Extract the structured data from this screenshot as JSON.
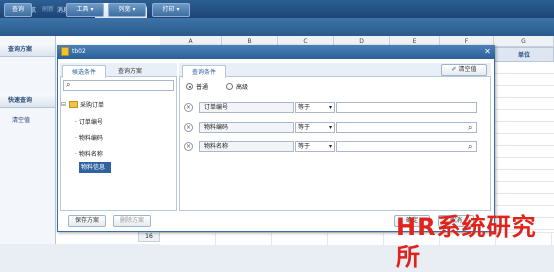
{
  "topnav": {
    "tabs": [
      "功能导航",
      "消息中心",
      "tb02"
    ],
    "active_index": 2
  },
  "toolbar": {
    "query": "查询",
    "refresh": "刷新",
    "tools": "工具",
    "columns": "列宽",
    "print": "打印"
  },
  "left": {
    "query_scheme": "查询方案",
    "quick_query": "快速查询",
    "clear": "清空值"
  },
  "sheet": {
    "columns": [
      "A",
      "B",
      "C",
      "D",
      "E",
      "F",
      "G"
    ],
    "unit_header": "单位",
    "row_number": "16"
  },
  "dialog": {
    "title": "tb02",
    "tabs": {
      "candidate": "候选条件",
      "scheme": "查询方案"
    },
    "tree": {
      "root": "采购订单",
      "children": [
        "订单编号",
        "物料编码",
        "物料名称",
        "物料信息"
      ],
      "selected_index": 3
    },
    "conditions_tab": "查询条件",
    "clear_button": "清空值",
    "mode": {
      "normal": "普通",
      "advanced": "高级",
      "selected": "normal"
    },
    "rows": [
      {
        "field": "订单编号",
        "op": "等于",
        "has_search": false
      },
      {
        "field": "物料编码",
        "op": "等于",
        "has_search": true
      },
      {
        "field": "物料名称",
        "op": "等于",
        "has_search": true
      }
    ],
    "save_button": "保存方案",
    "delete_button": "删除方案",
    "ok_button": "确定",
    "cancel_button": "取消"
  },
  "watermark": "HR系统研究所"
}
